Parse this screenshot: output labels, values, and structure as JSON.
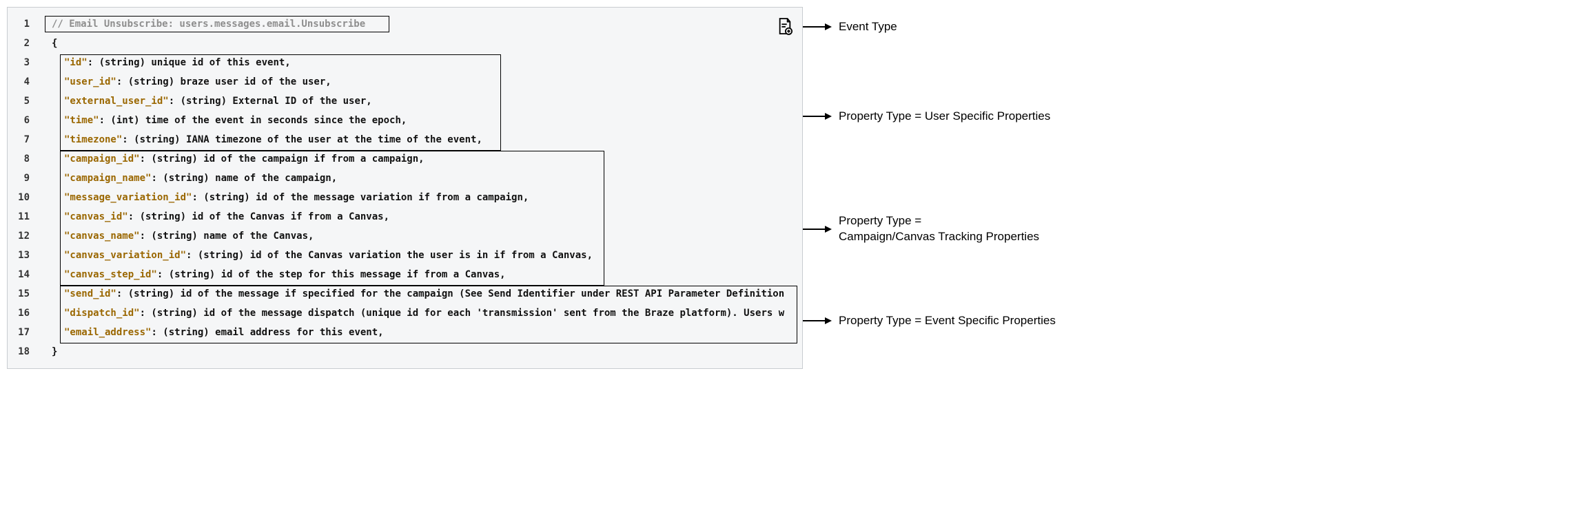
{
  "header_comment": "// Email Unsubscribe: users.messages.email.Unsubscribe",
  "braces": {
    "open": "{",
    "close": "}"
  },
  "lines": [
    {
      "num": "1"
    },
    {
      "num": "2"
    },
    {
      "num": "3",
      "key": "\"id\"",
      "desc": ": (string) unique id of this event,"
    },
    {
      "num": "4",
      "key": "\"user_id\"",
      "desc": ": (string) braze user id of the user,"
    },
    {
      "num": "5",
      "key": "\"external_user_id\"",
      "desc": ": (string) External ID of the user,"
    },
    {
      "num": "6",
      "key": "\"time\"",
      "desc": ": (int) time of the event in seconds since the epoch,"
    },
    {
      "num": "7",
      "key": "\"timezone\"",
      "desc": ": (string) IANA timezone of the user at the time of the event,"
    },
    {
      "num": "8",
      "key": "\"campaign_id\"",
      "desc": ": (string) id of the campaign if from a campaign,"
    },
    {
      "num": "9",
      "key": "\"campaign_name\"",
      "desc": ": (string) name of the campaign,"
    },
    {
      "num": "10",
      "key": "\"message_variation_id\"",
      "desc": ": (string) id of the message variation if from a campaign,"
    },
    {
      "num": "11",
      "key": "\"canvas_id\"",
      "desc": ": (string) id of the Canvas if from a Canvas,"
    },
    {
      "num": "12",
      "key": "\"canvas_name\"",
      "desc": ": (string) name of the Canvas,"
    },
    {
      "num": "13",
      "key": "\"canvas_variation_id\"",
      "desc": ": (string) id of the Canvas variation the user is in if from a Canvas,"
    },
    {
      "num": "14",
      "key": "\"canvas_step_id\"",
      "desc": ": (string) id of the step for this message if from a Canvas,"
    },
    {
      "num": "15",
      "key": "\"send_id\"",
      "desc": ": (string) id of the message if specified for the campaign (See Send Identifier under REST API Parameter Definition"
    },
    {
      "num": "16",
      "key": "\"dispatch_id\"",
      "desc": ": (string) id of the message dispatch (unique id for each 'transmission' sent from the Braze platform). Users w"
    },
    {
      "num": "17",
      "key": "\"email_address\"",
      "desc": ": (string) email address for this event,"
    },
    {
      "num": "18"
    }
  ],
  "annotations": {
    "event_type": "Event Type",
    "user_props": "Property Type = User Specific Properties",
    "campaign_props_line1": "Property Type =",
    "campaign_props_line2": "Campaign/Canvas Tracking Properties",
    "event_props": "Property Type = Event Specific Properties"
  }
}
